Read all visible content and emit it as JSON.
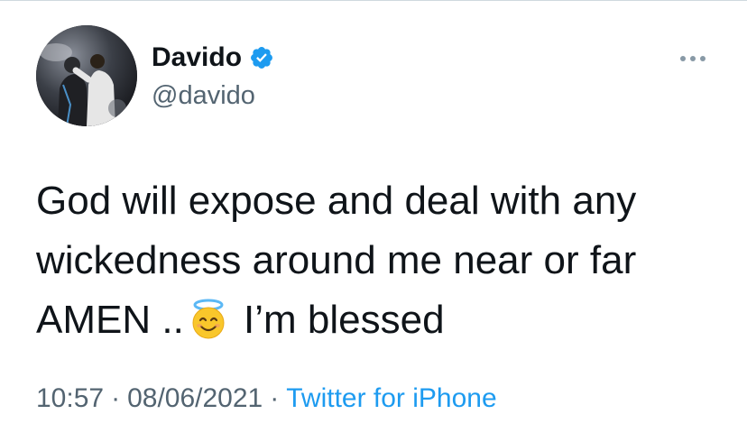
{
  "author": {
    "display_name": "Davido",
    "handle": "@davido",
    "verified": true,
    "avatar_icon": "profile-photo"
  },
  "tweet": {
    "text_before_emoji": "God will expose and deal with any\nwickedness around me near or far\nAMEN ..",
    "emoji": "smiling-face-with-halo",
    "text_after_emoji": " I’m blessed"
  },
  "meta": {
    "time": "10:57",
    "separator": "·",
    "date": "08/06/2021",
    "source": "Twitter for iPhone"
  },
  "colors": {
    "verified_blue": "#1d9bf0",
    "secondary_text": "#536471",
    "link": "#1d9bf0"
  },
  "icons": {
    "more": "more-horizontal-icon",
    "verified": "verified-badge-icon"
  }
}
